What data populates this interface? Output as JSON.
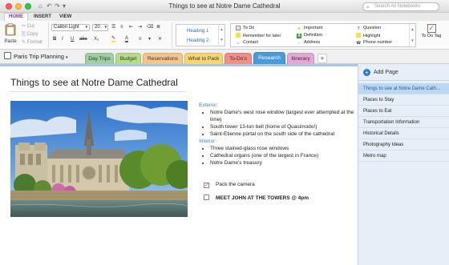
{
  "window": {
    "title": "Things to see at Notre Dame Cathedral",
    "search_placeholder": "Search All Notebooks"
  },
  "ribbon_tabs": [
    "HOME",
    "INSERT",
    "VIEW"
  ],
  "ribbon": {
    "paste_label": "Paste",
    "cut_label": "Cut",
    "copy_label": "Copy",
    "format_label": "Format",
    "font_name": "Calibri Light",
    "font_size": "20",
    "bold": "B",
    "italic": "I",
    "underline": "U",
    "strike": "abc",
    "subscript": "X₂",
    "heading1": "Heading 1",
    "heading2": "Heading 2",
    "tags": [
      {
        "label": "To Do",
        "icon": "checkbox-icon",
        "color": "#d94a4a"
      },
      {
        "label": "Remember for later",
        "icon": "highlighter-icon",
        "color": "#f2c200"
      },
      {
        "label": "Contact",
        "icon": "contact-icon",
        "color": "#4a8fd3"
      },
      {
        "label": "Important",
        "icon": "star-icon",
        "color": "#f2b600"
      },
      {
        "label": "Definition",
        "icon": "definition-icon",
        "color": "#3a9a3a"
      },
      {
        "label": "Address",
        "icon": "address-icon",
        "color": "#5a8ed6"
      },
      {
        "label": "Question",
        "icon": "question-icon",
        "color": "#7a4fb5"
      },
      {
        "label": "Highlight",
        "icon": "highlight-icon",
        "color": "#f2d200"
      },
      {
        "label": "Phone number",
        "icon": "phone-icon",
        "color": "#555555"
      }
    ],
    "todo_tag_label": "To Do Tag"
  },
  "notebook": {
    "name": "Paris Trip Planning"
  },
  "sections": [
    {
      "label": "Day Trips",
      "color": "#9fd0a2"
    },
    {
      "label": "Budget",
      "color": "#b5dd88"
    },
    {
      "label": "Reservations",
      "color": "#f4c48f"
    },
    {
      "label": "What to Pack",
      "color": "#f5d672"
    },
    {
      "label": "To-Do's",
      "color": "#f28e88"
    },
    {
      "label": "Research",
      "color": "#4a9ad8",
      "active": true
    },
    {
      "label": "Itinerary",
      "color": "#e4a8d6"
    }
  ],
  "page": {
    "title": "Things to see at Notre Dame Cathedral",
    "exterior_label": "Exterior:",
    "exterior_items": [
      "Notre Dame's west rose window (largest ever attempted at the time)",
      "South tower 13-ton bell (home of Quasimodo!)",
      "Saint-Etienne portal on the south side of the cathedral"
    ],
    "interior_label": "Interior:",
    "interior_items": [
      "Three stained-glass rose windows",
      "Cathedral organs (one of the largest in France)",
      "Notre Dame's treasury"
    ],
    "todo_items": [
      {
        "text": "Pack the camera",
        "checked": true
      },
      {
        "text": "MEET JOHN AT THE TOWERS @ 4pm",
        "checked": false
      }
    ]
  },
  "pages_pane": {
    "add_page_label": "Add Page",
    "pages": [
      {
        "label": "Things to see at Notre Dame Cath...",
        "selected": true
      },
      {
        "label": "Places to Stay"
      },
      {
        "label": "Places to Eat"
      },
      {
        "label": "Transportation Information"
      },
      {
        "label": "Historical Details"
      },
      {
        "label": "Photography Ideas"
      },
      {
        "label": "Metro map"
      }
    ]
  }
}
